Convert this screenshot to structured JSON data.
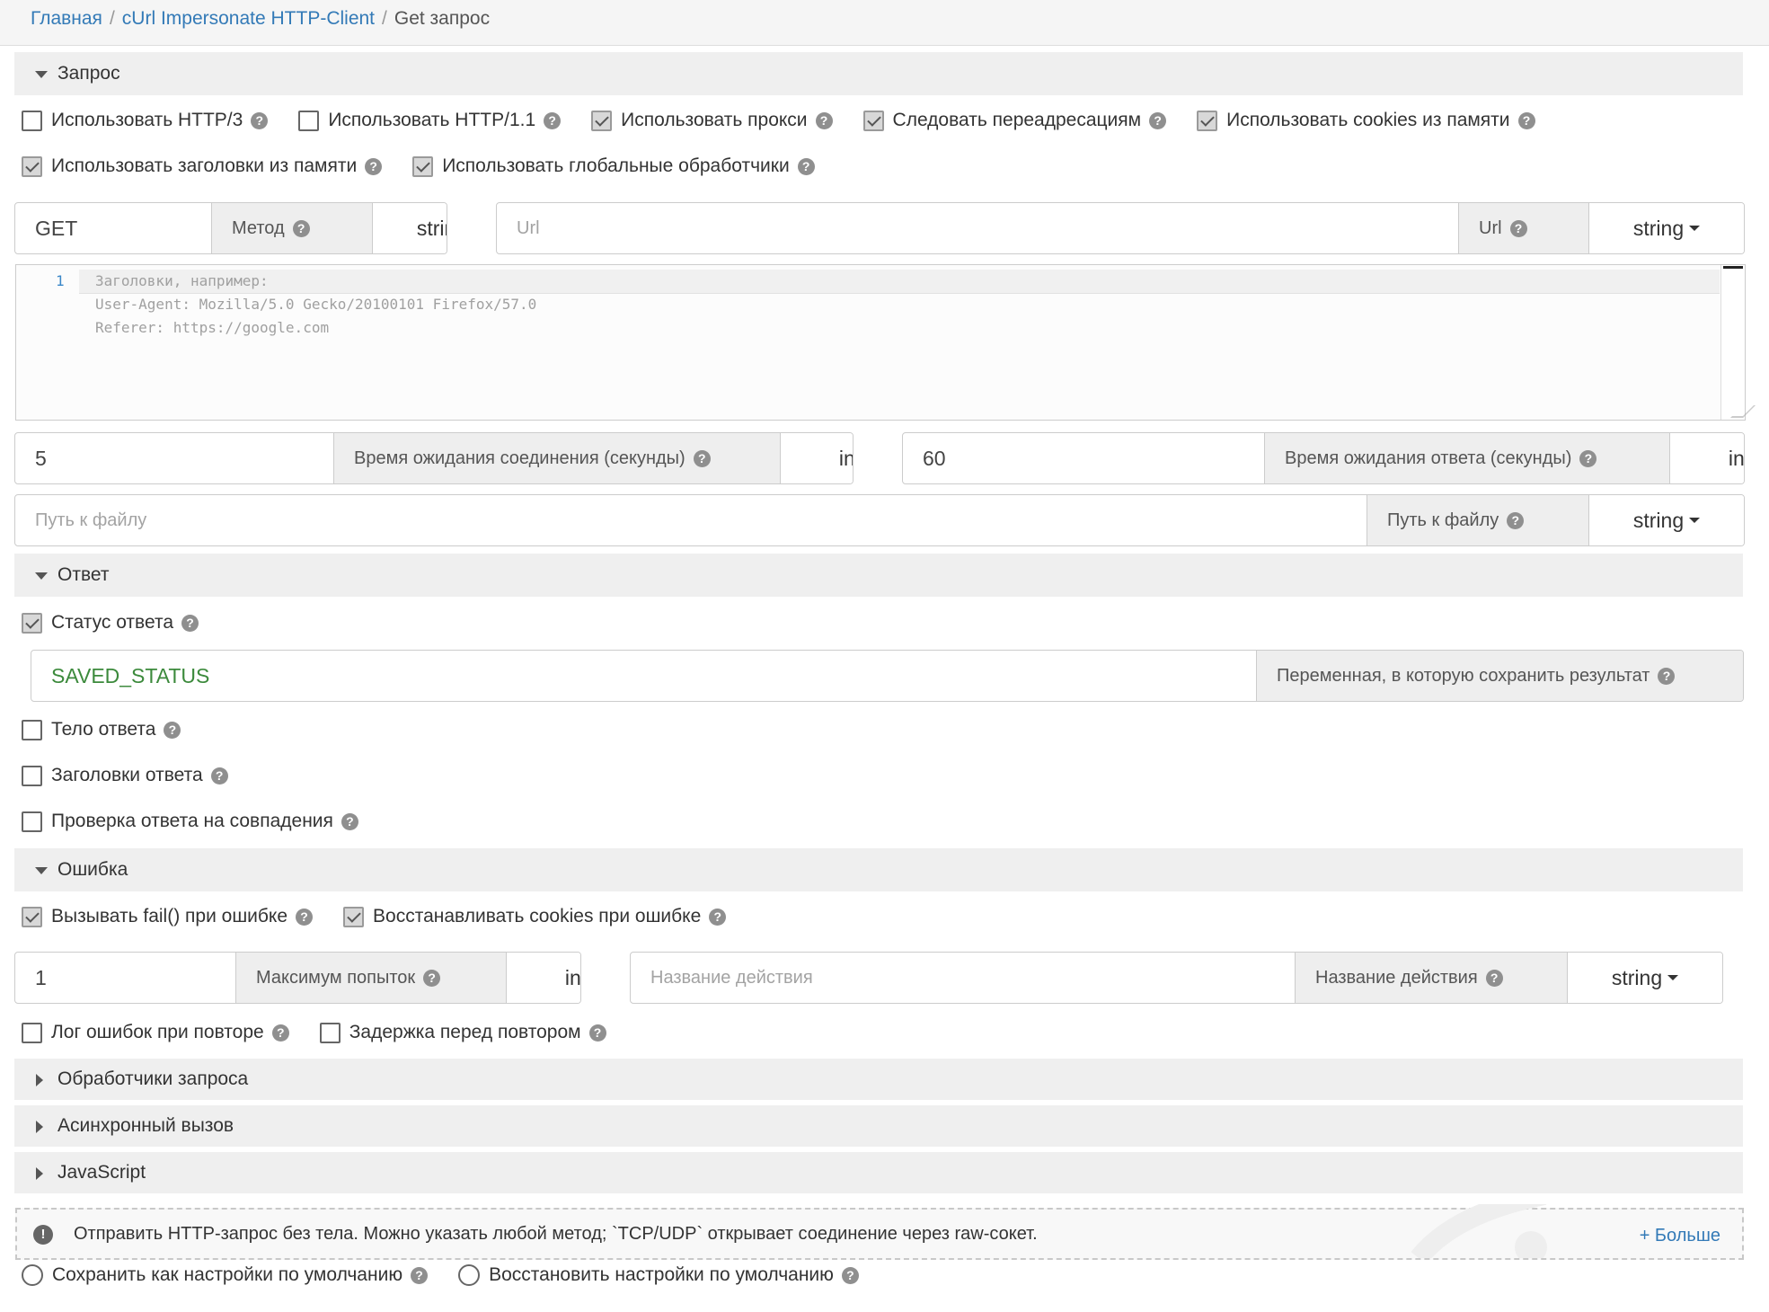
{
  "breadcrumb": {
    "home": "Главная",
    "section": "cUrl Impersonate HTTP-Client",
    "current": "Get запрос"
  },
  "request": {
    "title": "Запрос",
    "checks": [
      {
        "label": "Использовать HTTP/3",
        "checked": false
      },
      {
        "label": "Использовать HTTP/1.1",
        "checked": false
      },
      {
        "label": "Использовать прокси",
        "checked": true
      },
      {
        "label": "Следовать переадресациям",
        "checked": true
      },
      {
        "label": "Использовать cookies из памяти",
        "checked": true
      },
      {
        "label": "Использовать заголовки из памяти",
        "checked": true
      },
      {
        "label": "Использовать глобальные обработчики",
        "checked": true
      }
    ],
    "method": {
      "value": "GET",
      "label": "Метод",
      "type": "string"
    },
    "url": {
      "placeholder": "Url",
      "label": "Url",
      "type": "string"
    },
    "headers_editor": {
      "line_number": "1",
      "placeholder_lines": [
        "Заголовки, например:",
        "User-Agent: Mozilla/5.0 Gecko/20100101 Firefox/57.0",
        "Referer: https://google.com"
      ]
    },
    "connect_timeout": {
      "value": "5",
      "label": "Время ожидания соединения (секунды)",
      "type": "int"
    },
    "response_timeout": {
      "value": "60",
      "label": "Время ожидания ответа (секунды)",
      "type": "int"
    },
    "file_path": {
      "placeholder": "Путь к файлу",
      "label": "Путь к файлу",
      "type": "string"
    }
  },
  "response": {
    "title": "Ответ",
    "status_check": {
      "label": "Статус ответа",
      "checked": true
    },
    "save_var": {
      "value": "SAVED_STATUS",
      "label": "Переменная, в которую сохранить результат"
    },
    "checks": [
      {
        "label": "Тело ответа",
        "checked": false
      },
      {
        "label": "Заголовки ответа",
        "checked": false
      },
      {
        "label": "Проверка ответа на совпадения",
        "checked": false
      }
    ]
  },
  "error": {
    "title": "Ошибка",
    "checks": [
      {
        "label": "Вызывать fail() при ошибке",
        "checked": true
      },
      {
        "label": "Восстанавливать cookies при ошибке",
        "checked": true
      }
    ],
    "max_attempts": {
      "value": "1",
      "label": "Максимум попыток",
      "type": "int"
    },
    "action_name": {
      "placeholder": "Название действия",
      "label": "Название действия",
      "type": "string"
    },
    "retry_checks": [
      {
        "label": "Лог ошибок при повторе",
        "checked": false
      },
      {
        "label": "Задержка перед повтором",
        "checked": false
      }
    ]
  },
  "collapsed_sections": [
    "Обработчики запроса",
    "Асинхронный вызов",
    "JavaScript"
  ],
  "info": {
    "icon": "!",
    "text": "Отправить HTTP-запрос без тела. Можно указать любой метод; `TCP/UDP` открывает соединение через raw-сокет.",
    "more": "+ Больше"
  },
  "footer": {
    "save_default": "Сохранить как настройки по умолчанию",
    "restore_default": "Восстановить настройки по умолчанию"
  },
  "help_glyph": "?"
}
